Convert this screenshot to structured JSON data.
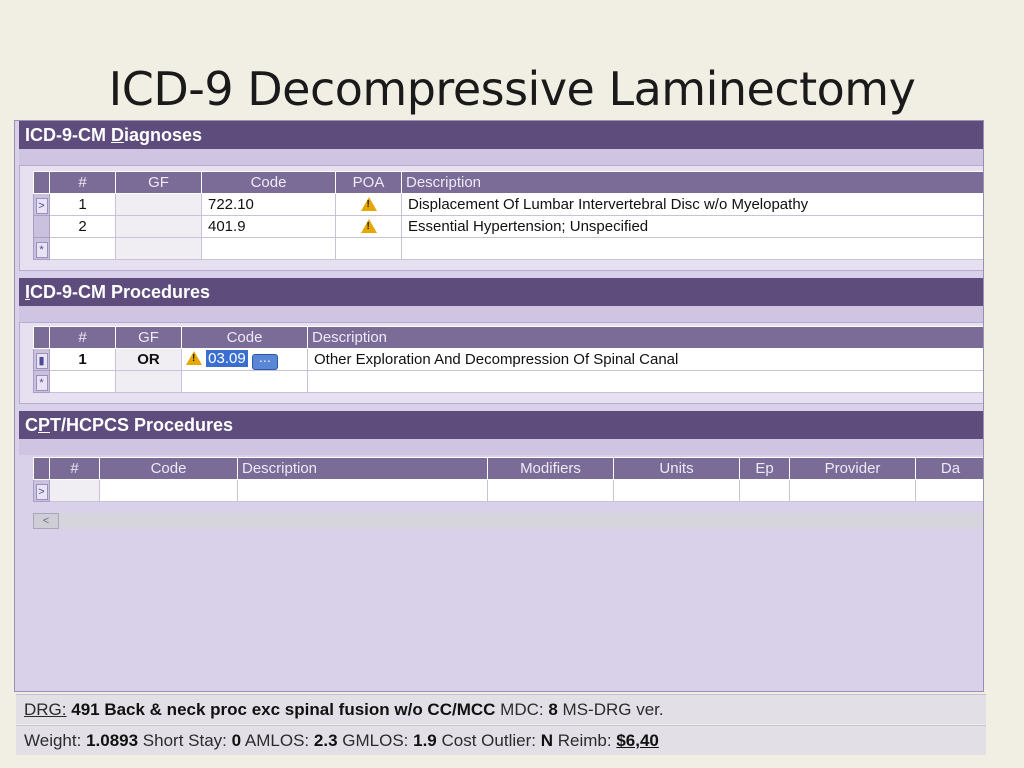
{
  "slide": {
    "title": "ICD-9 Decompressive Laminectomy"
  },
  "diagnoses": {
    "header_prefix": "ICD-9-CM ",
    "header_underlined": "D",
    "header_suffix": "iagnoses",
    "columns": [
      "#",
      "GF",
      "Code",
      "POA",
      "Description"
    ],
    "rows": [
      {
        "num": "1",
        "gf": "",
        "code": "722.10",
        "poa_icon": "warning-icon",
        "description": "Displacement Of Lumbar Intervertebral Disc w/o Myelopathy"
      },
      {
        "num": "2",
        "gf": "",
        "code": "401.9",
        "poa_icon": "warning-icon",
        "description": "Essential Hypertension; Unspecified"
      }
    ]
  },
  "procedures": {
    "header_underlined": "I",
    "header_suffix": "CD-9-CM Procedures",
    "columns": [
      "#",
      "GF",
      "Code",
      "Description"
    ],
    "rows": [
      {
        "num": "1",
        "gf": "OR",
        "code": "03.09",
        "description": "Other Exploration And Decompression Of Spinal Canal"
      }
    ]
  },
  "cpt": {
    "header_prefix": "C",
    "header_underlined": "P",
    "header_suffix": "T/HCPCS Procedures",
    "columns": [
      "#",
      "Code",
      "Description",
      "Modifiers",
      "Units",
      "Ep",
      "Provider",
      "Da"
    ]
  },
  "status": {
    "drg_label": "DRG:",
    "drg_value": "491 Back & neck proc exc spinal fusion w/o CC/MCC",
    "mdc_label": "MDC:",
    "mdc_value": "8",
    "msdrg_label": "MS-DRG ver.",
    "weight_label": "Weight:",
    "weight_value": "1.0893",
    "short_stay_label": "Short Stay:",
    "short_stay_value": "0",
    "amlos_label": "AMLOS:",
    "amlos_value": "2.3",
    "gmlos_label": "GMLOS:",
    "gmlos_value": "1.9",
    "cost_outlier_label": "Cost Outlier:",
    "cost_outlier_value": "N",
    "reimb_label": "Reimb:",
    "reimb_value": "$6,40"
  },
  "colors": {
    "header": "#5e4c7d",
    "column_header": "#7a6b97",
    "panel": "#d9d1ea",
    "highlight": "#3a6fd1",
    "warning": "#e6a800"
  }
}
